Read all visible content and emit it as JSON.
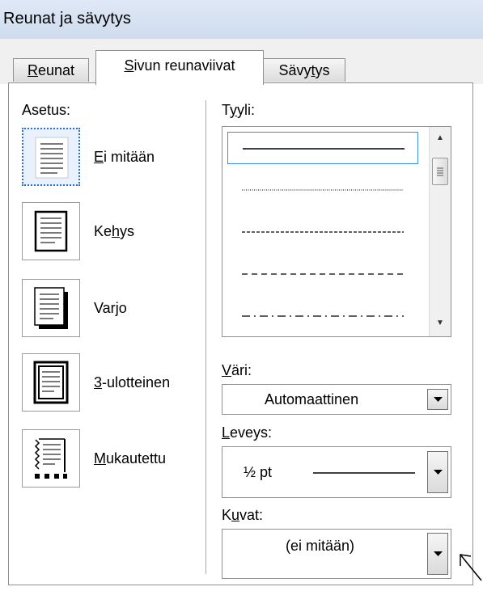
{
  "dialog": {
    "title": "Reunat ja sävytys"
  },
  "tabs": [
    {
      "pre": "",
      "key": "R",
      "post": "eunat",
      "active": false
    },
    {
      "pre": "",
      "key": "S",
      "post": "ivun reunaviivat",
      "active": true
    },
    {
      "pre": "Sävy",
      "key": "t",
      "post": "ys",
      "active": false
    }
  ],
  "setting": {
    "heading": "Asetus:",
    "items": [
      {
        "pre": "",
        "key": "E",
        "post": "i mitään",
        "selected": true,
        "icon": "page-no-border-icon"
      },
      {
        "pre": "Ke",
        "key": "h",
        "post": "ys",
        "selected": false,
        "icon": "page-box-border-icon"
      },
      {
        "pre": "Var",
        "key": "j",
        "post": "o",
        "selected": false,
        "icon": "page-shadow-border-icon"
      },
      {
        "pre": "",
        "key": "3",
        "post": "-ulotteinen",
        "selected": false,
        "icon": "page-3d-border-icon"
      },
      {
        "pre": "",
        "key": "M",
        "post": "ukautettu",
        "selected": false,
        "icon": "page-custom-border-icon"
      }
    ]
  },
  "style": {
    "label_pre": "T",
    "label_key": "y",
    "label_post": "yli:",
    "lines": [
      "solid",
      "dotted",
      "dashed-small",
      "dashed",
      "dash-dot"
    ]
  },
  "color": {
    "label_pre": "",
    "label_key": "V",
    "label_post": "äri:",
    "value": "Automaattinen"
  },
  "width": {
    "label_pre": "",
    "label_key": "L",
    "label_post": "eveys:",
    "value": "½ pt"
  },
  "art": {
    "label_pre": "K",
    "label_key": "u",
    "label_post": "vat:",
    "value": "(ei mitään)"
  }
}
